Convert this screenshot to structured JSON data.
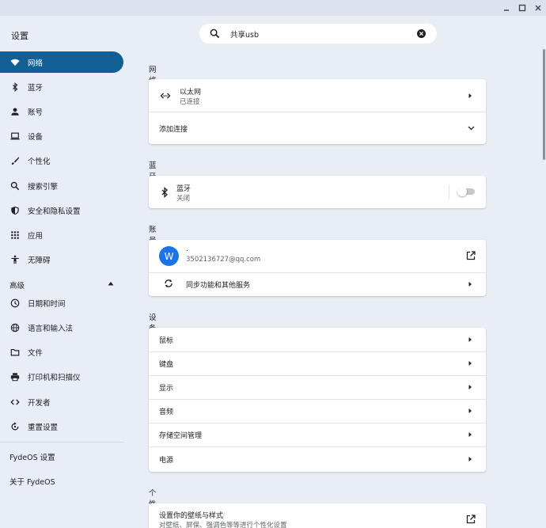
{
  "app": {
    "title": "设置"
  },
  "search": {
    "query": "共享usb"
  },
  "sidebar": {
    "items": [
      {
        "label": "网络",
        "icon": "wifi-icon"
      },
      {
        "label": "蓝牙",
        "icon": "bluetooth-icon"
      },
      {
        "label": "账号",
        "icon": "person-icon"
      },
      {
        "label": "设备",
        "icon": "laptop-icon"
      },
      {
        "label": "个性化",
        "icon": "brush-icon"
      },
      {
        "label": "搜索引擎",
        "icon": "search-icon"
      },
      {
        "label": "安全和隐私设置",
        "icon": "shield-icon"
      },
      {
        "label": "应用",
        "icon": "apps-grid-icon"
      },
      {
        "label": "无障碍",
        "icon": "accessibility-icon"
      }
    ],
    "advanced_label": "高级",
    "advanced_items": [
      {
        "label": "日期和时间",
        "icon": "clock-icon"
      },
      {
        "label": "语言和输入法",
        "icon": "globe-icon"
      },
      {
        "label": "文件",
        "icon": "folder-icon"
      },
      {
        "label": "打印机和扫描仪",
        "icon": "printer-icon"
      },
      {
        "label": "开发者",
        "icon": "code-icon"
      },
      {
        "label": "重置设置",
        "icon": "reset-icon"
      }
    ],
    "footer_items": [
      {
        "label": "FydeOS 设置"
      },
      {
        "label": "关于 FydeOS"
      }
    ]
  },
  "network": {
    "title": "网络",
    "ethernet_label": "以太网",
    "ethernet_status": "已连接",
    "add_connection": "添加连接"
  },
  "bluetooth": {
    "title": "蓝牙",
    "label": "蓝牙",
    "status": "关闭"
  },
  "account": {
    "title": "账号",
    "avatar_letter": "W",
    "name": ".",
    "email": "3502136727@qq.com",
    "sync_label": "同步功能和其他服务"
  },
  "device": {
    "title": "设备",
    "rows": [
      "鼠标",
      "键盘",
      "显示",
      "音频",
      "存储空间管理",
      "电源"
    ]
  },
  "personalization": {
    "title": "个性化",
    "wallpaper_label": "设置你的壁纸与样式",
    "wallpaper_desc": "对壁纸、屏保、强调色等等进行个性化设置"
  }
}
